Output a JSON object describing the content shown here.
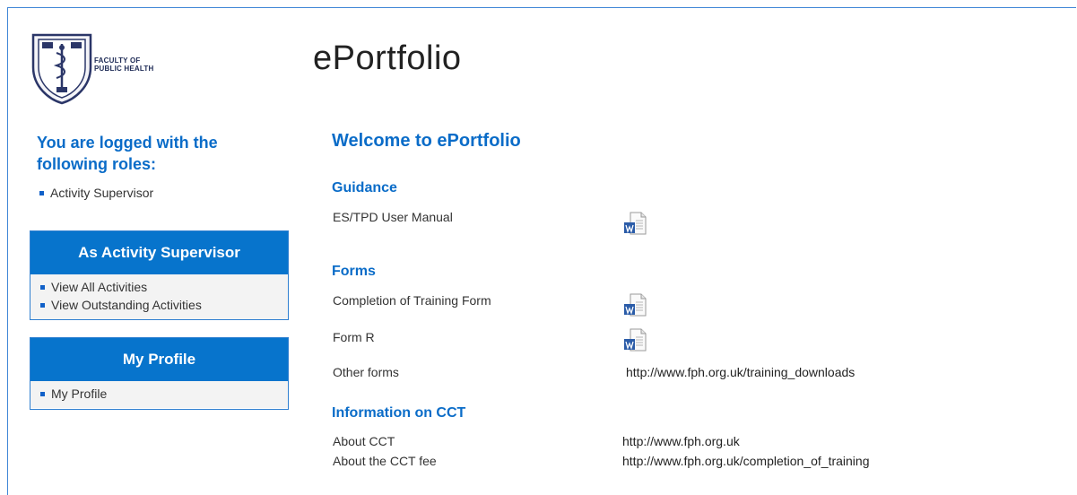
{
  "header": {
    "logo_text_line1": "FACULTY OF",
    "logo_text_line2": "PUBLIC HEALTH",
    "app_title": "ePortfolio"
  },
  "sidebar": {
    "roles_heading": "You are logged with the following roles:",
    "roles": [
      "Activity Supervisor"
    ],
    "panels": [
      {
        "title": "As Activity Supervisor",
        "items": [
          "View All Activities",
          "View Outstanding Activities"
        ]
      },
      {
        "title": "My Profile",
        "items": [
          "My Profile"
        ]
      }
    ]
  },
  "main": {
    "welcome": "Welcome to ePortfolio",
    "sections": [
      {
        "title": "Guidance",
        "rows": [
          {
            "label": "ES/TPD User Manual",
            "icon": "word-document-icon"
          }
        ]
      },
      {
        "title": "Forms",
        "rows": [
          {
            "label": "Completion of Training Form",
            "icon": "word-document-icon"
          },
          {
            "label": "Form R",
            "icon": "word-document-icon"
          },
          {
            "label": "Other forms",
            "link": "http://www.fph.org.uk/training_downloads"
          }
        ]
      },
      {
        "title": "Information on CCT",
        "rows": [
          {
            "label": "About CCT",
            "link": "http://www.fph.org.uk"
          },
          {
            "label": "About the CCT fee",
            "link": "http://www.fph.org.uk/completion_of_training"
          }
        ]
      }
    ]
  },
  "colors": {
    "accent": "#0774cc",
    "heading": "#0a6cc8",
    "frame_border": "#3f86d6"
  }
}
